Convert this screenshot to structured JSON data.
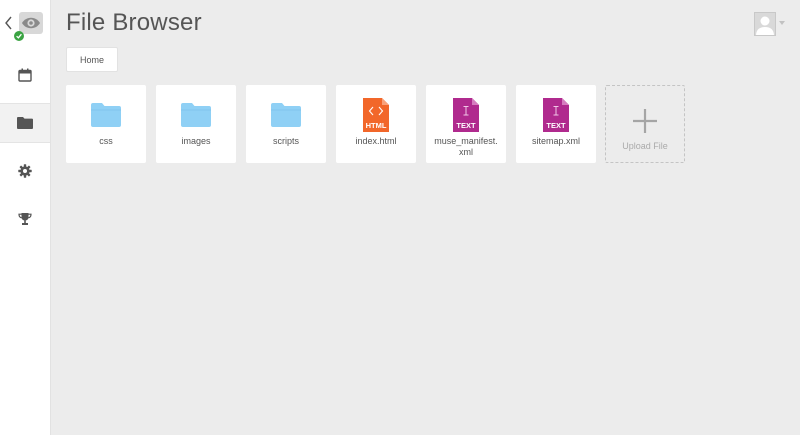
{
  "page": {
    "title": "File Browser"
  },
  "breadcrumb": {
    "items": [
      "Home"
    ]
  },
  "sidebar": {
    "items": [
      {
        "name": "calendar",
        "icon": "calendar-icon"
      },
      {
        "name": "files",
        "icon": "folder-icon",
        "active": true
      },
      {
        "name": "settings",
        "icon": "gear-icon"
      },
      {
        "name": "achievements",
        "icon": "trophy-icon"
      }
    ]
  },
  "files": [
    {
      "name": "css",
      "type": "folder",
      "icon": "folder-icon"
    },
    {
      "name": "images",
      "type": "folder",
      "icon": "folder-icon"
    },
    {
      "name": "scripts",
      "type": "folder",
      "icon": "folder-icon"
    },
    {
      "name": "index.html",
      "type": "html",
      "icon": "html-file-icon",
      "badge": "HTML"
    },
    {
      "name": "muse_manifest.xml",
      "type": "text",
      "icon": "text-file-icon",
      "badge": "TEXT"
    },
    {
      "name": "sitemap.xml",
      "type": "text",
      "icon": "text-file-icon",
      "badge": "TEXT"
    }
  ],
  "upload": {
    "label": "Upload File",
    "icon": "plus-icon"
  },
  "colors": {
    "folder": "#8fd0f5",
    "html_file": "#f2672a",
    "text_file": "#b02a8e",
    "status_ok": "#3aa342"
  }
}
